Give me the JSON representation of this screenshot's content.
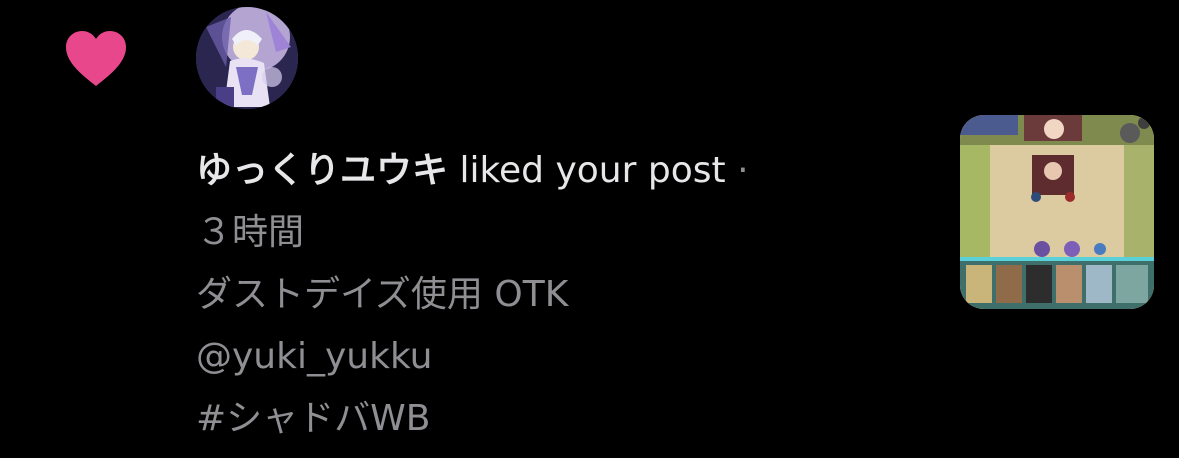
{
  "notification": {
    "icon": "heart-icon",
    "icon_color": "#e8478b",
    "avatar": "user-avatar-anime-character",
    "username": "ゆっくりユウキ",
    "action_text": "liked your post",
    "separator": "·",
    "timestamp": "３時間",
    "post_title": "ダストデイズ使用 OTK",
    "post_mention": "@yuki_yukku",
    "post_hashtag": "#シャドバWB",
    "thumbnail": "post-thumbnail-game-screenshot"
  },
  "colors": {
    "background": "#000000",
    "primary_text": "#e7e7ea",
    "secondary_text": "#8e8e93",
    "heart": "#e8478b"
  }
}
